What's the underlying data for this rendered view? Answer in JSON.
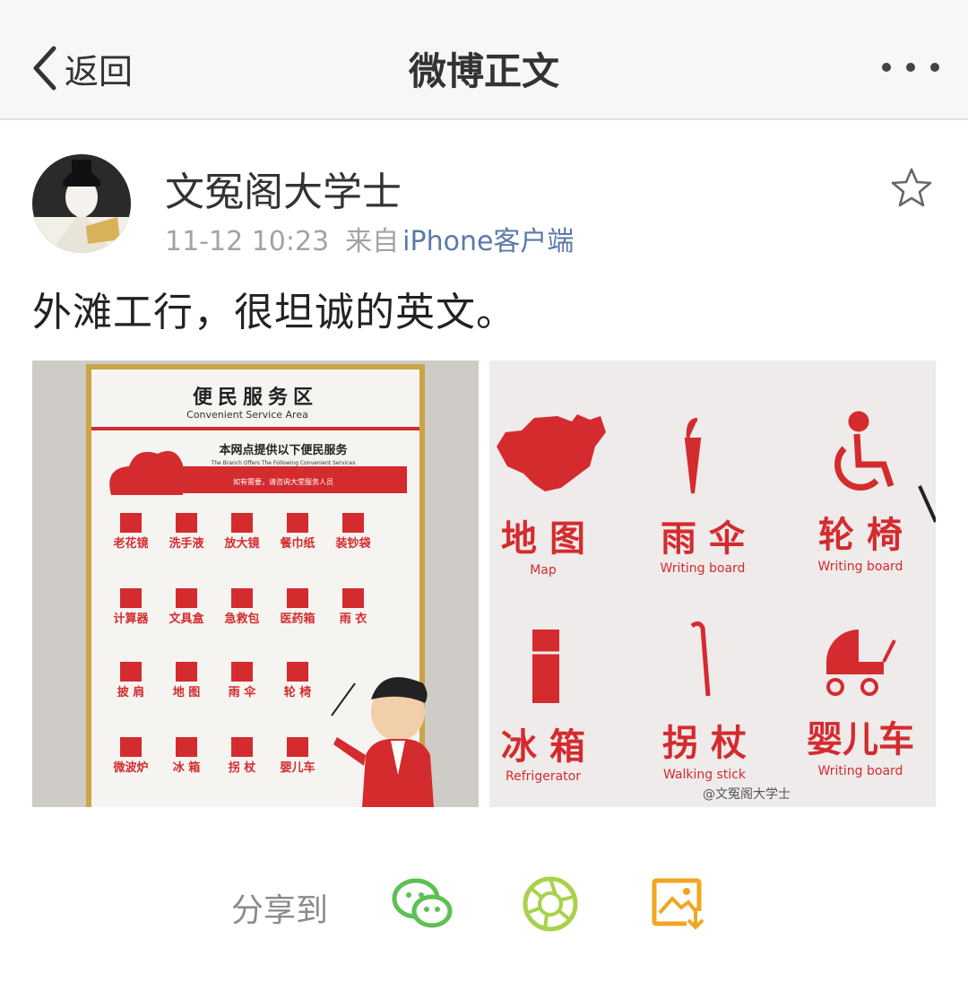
{
  "nav": {
    "back_label": "返回",
    "title": "微博正文",
    "more_icon": "more-dots-icon"
  },
  "post": {
    "author": "文冤阁大学士",
    "time": "11-12 10:23",
    "source_prefix": "来自",
    "source": "iPhone客户端",
    "text": "外滩工行，很坦诚的英文。"
  },
  "image_left": {
    "title_cn": "便民服务区",
    "title_en": "Convenient Service Area",
    "banner_cn": "本网点提供以下便民服务",
    "banner_en": "The Branch Offers The Following Convenient Services",
    "banner_note": "如有需要，请咨询大堂服务人员",
    "items": [
      {
        "cn": "老花镜"
      },
      {
        "cn": "洗手液"
      },
      {
        "cn": "放大镜"
      },
      {
        "cn": "餐巾纸"
      },
      {
        "cn": "装钞袋"
      },
      {
        "cn": "计算器"
      },
      {
        "cn": "文具盒"
      },
      {
        "cn": "急救包"
      },
      {
        "cn": "医药箱"
      },
      {
        "cn": "雨 衣"
      },
      {
        "cn": "披 肩"
      },
      {
        "cn": "地 图"
      },
      {
        "cn": "雨 伞"
      },
      {
        "cn": "轮 椅"
      },
      {
        "cn": ""
      },
      {
        "cn": "微波炉"
      },
      {
        "cn": "冰 箱"
      },
      {
        "cn": "拐 杖"
      },
      {
        "cn": "婴儿车"
      },
      {
        "cn": ""
      }
    ]
  },
  "image_right": {
    "items": [
      {
        "cn": "地 图",
        "en": "Map",
        "icon": "china-map-icon"
      },
      {
        "cn": "雨 伞",
        "en": "Writing board",
        "icon": "umbrella-icon"
      },
      {
        "cn": "轮 椅",
        "en": "Writing board",
        "icon": "wheelchair-icon"
      },
      {
        "cn": "冰 箱",
        "en": "Refrigerator",
        "icon": "refrigerator-icon"
      },
      {
        "cn": "拐 杖",
        "en": "Walking stick",
        "icon": "walking-stick-icon"
      },
      {
        "cn": "婴儿车",
        "en": "Writing board",
        "icon": "baby-stroller-icon"
      }
    ],
    "watermark": "@文冤阁大学士"
  },
  "share": {
    "label": "分享到",
    "targets": [
      "wechat-icon",
      "moments-icon",
      "save-image-icon"
    ]
  },
  "colors": {
    "sign_red": "#d42b2f",
    "link_blue": "#5b7aa8",
    "wechat_green": "#5fbf55",
    "moments_green": "#a8d24a",
    "save_orange": "#f1a622"
  }
}
